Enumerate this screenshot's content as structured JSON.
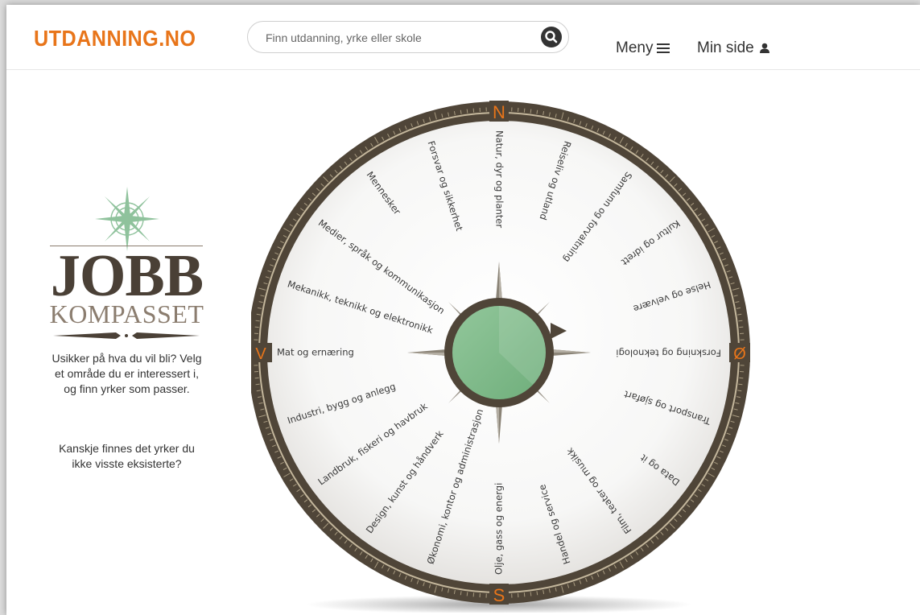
{
  "header": {
    "logo": "UTDANNING.NO",
    "search_placeholder": "Finn utdanning, yrke eller skole",
    "menu_label": "Meny",
    "minside_label": "Min side"
  },
  "intro": {
    "brand_title": "JOBB",
    "brand_subtitle": "KOMPASSET",
    "text1": "Usikker på hva du vil bli? Velg et område du er interessert i, og finn yrker som passer.",
    "text2": "Kanskje finnes det yrker du ikke visste eksisterte?"
  },
  "compass": {
    "north": "N",
    "east": "Ø",
    "south": "S",
    "west": "V",
    "categories": [
      "Natur, dyr og planter",
      "Reiseliv og utland",
      "Samfunn og forvaltning",
      "Kultur og idrett",
      "Helse og velvære",
      "Forskning og teknologi",
      "Transport og sjøfart",
      "Data og it",
      "Film, teater og musikk",
      "Handel og service",
      "Olje, gass og energi",
      "Økonomi, kontor og administrasjon",
      "Design, kunst og håndverk",
      "Landbruk, fiskeri og havbruk",
      "Industri, bygg og anlegg",
      "Mat og ernæring",
      "Mekanikk, teknikk og elektronikk",
      "Medier, språk og kommunikasjon",
      "Mennesker",
      "Forsvar og sikkerhet"
    ]
  },
  "colors": {
    "brand_orange": "#e8751a",
    "ring_brown": "#4f4538",
    "hub_green": "#7fbb8a"
  }
}
